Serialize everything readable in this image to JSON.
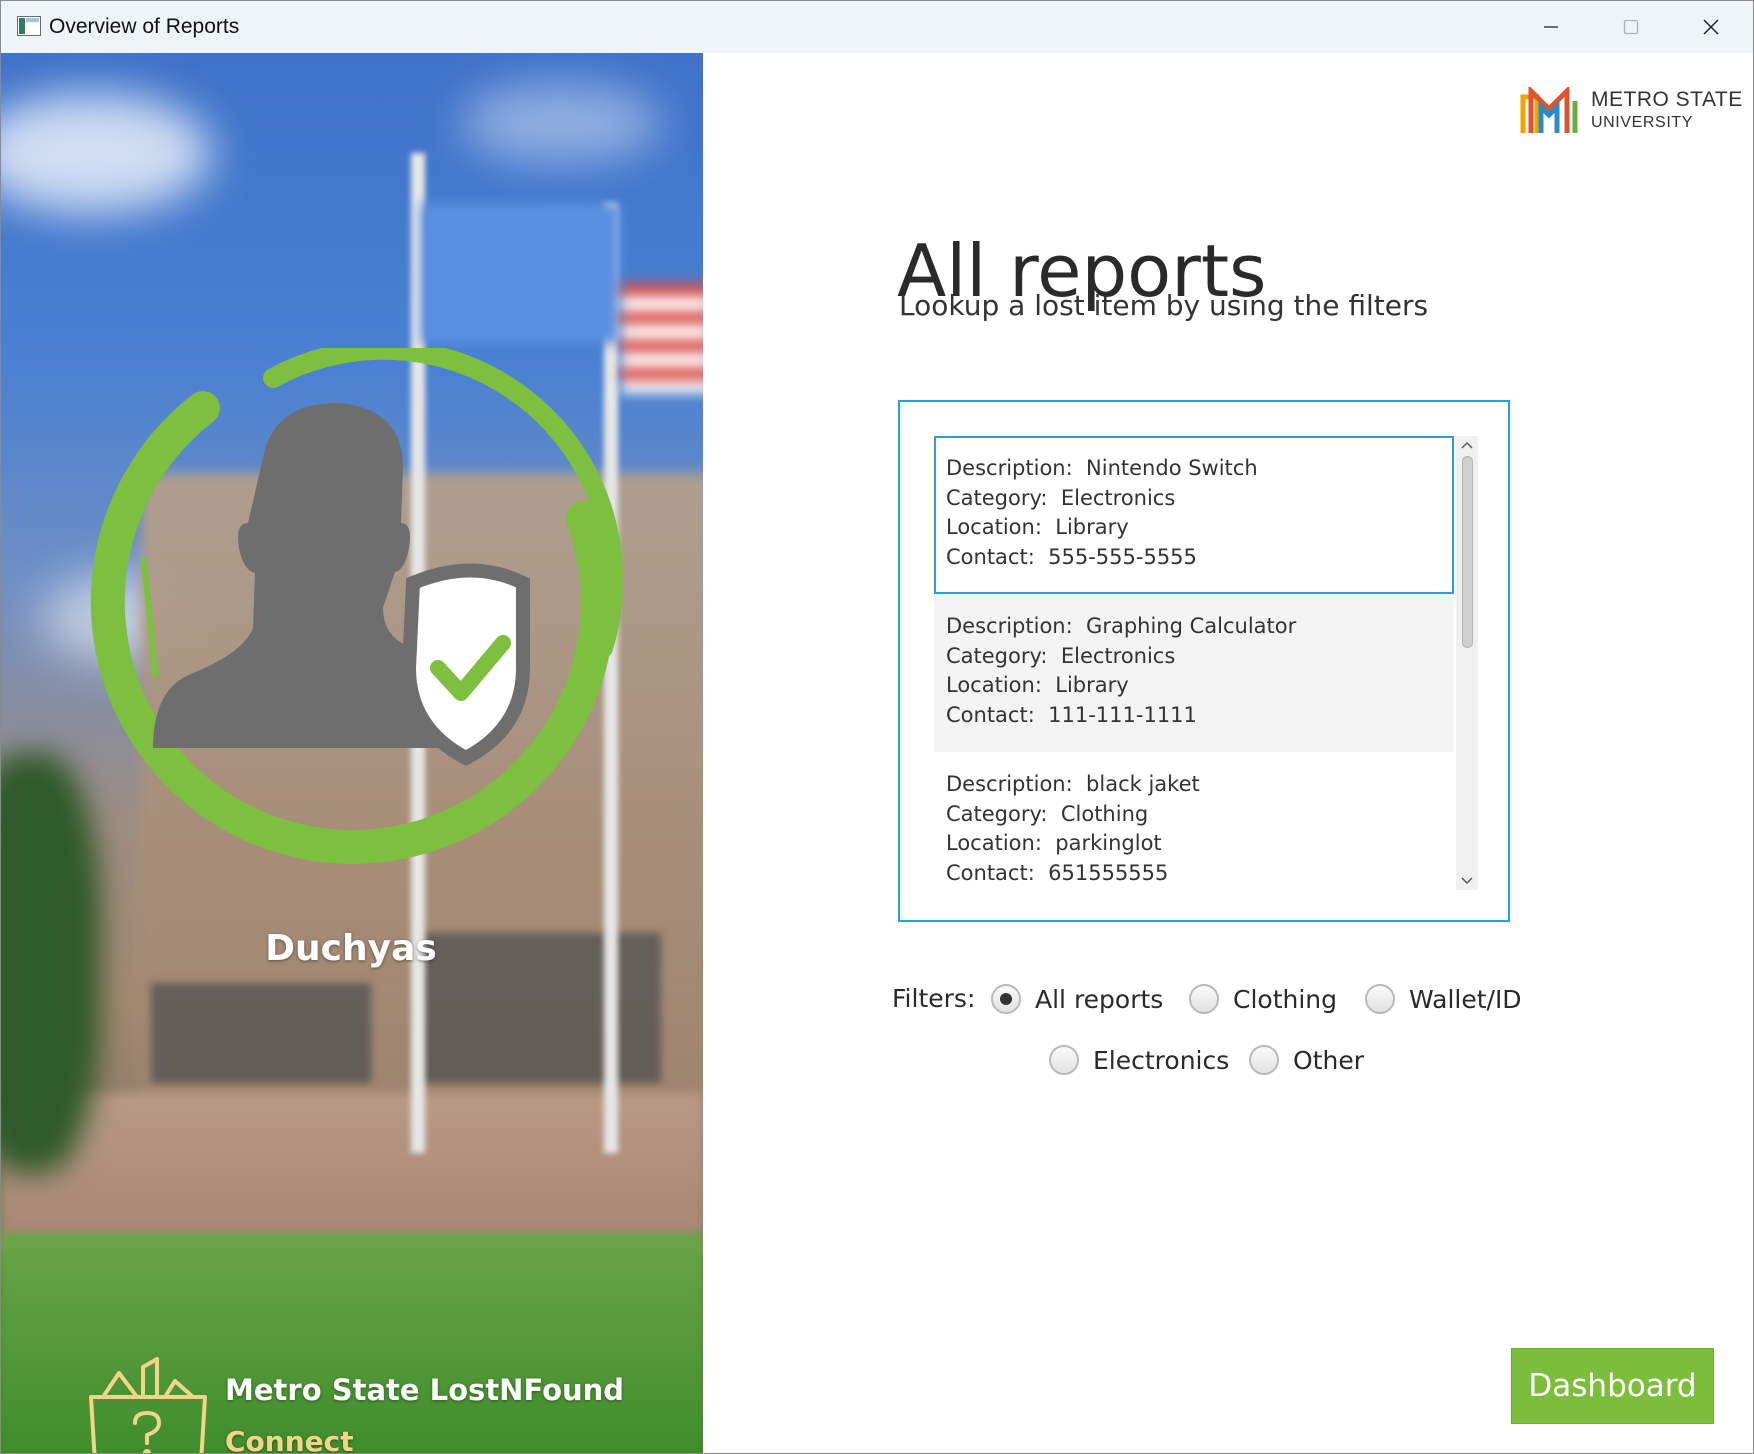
{
  "window": {
    "title": "Overview of Reports",
    "controls": {
      "minimize": "minimize",
      "maximize": "maximize",
      "close": "close"
    }
  },
  "sidebar": {
    "username": "Duchyas",
    "brand": {
      "line1": "Metro State LostNFound",
      "line2": "Connect"
    },
    "icons": {
      "avatar": "user-shield-icon",
      "brand": "lost-found-box-icon"
    }
  },
  "header": {
    "logo": {
      "name": "METRO STATE",
      "sub": "UNIVERSITY"
    }
  },
  "main": {
    "title": "All reports",
    "subtitle": "Lookup a lost item by using the filters",
    "field_labels": {
      "description": "Description:",
      "category": "Category:",
      "location": "Location:",
      "contact": "Contact:"
    },
    "reports": [
      {
        "description": "Nintendo Switch",
        "category": "Electronics",
        "location": "Library",
        "contact": "555-555-5555",
        "selected": true
      },
      {
        "description": "Graphing Calculator",
        "category": "Electronics",
        "location": "Library",
        "contact": "111-111-1111",
        "selected": false
      },
      {
        "description": "black jaket",
        "category": "Clothing",
        "location": "parkinglot",
        "contact": "651555555",
        "selected": false
      }
    ],
    "filters": {
      "label": "Filters:",
      "options": [
        {
          "label": "All reports",
          "checked": true
        },
        {
          "label": "Clothing",
          "checked": false
        },
        {
          "label": "Wallet/ID",
          "checked": false
        },
        {
          "label": "Electronics",
          "checked": false
        },
        {
          "label": "Other",
          "checked": false
        }
      ]
    },
    "dashboard_button": "Dashboard"
  },
  "colors": {
    "accent_green": "#7dbd3c",
    "list_border": "#1ea5d9",
    "brand_gold": "#f2d58a"
  }
}
